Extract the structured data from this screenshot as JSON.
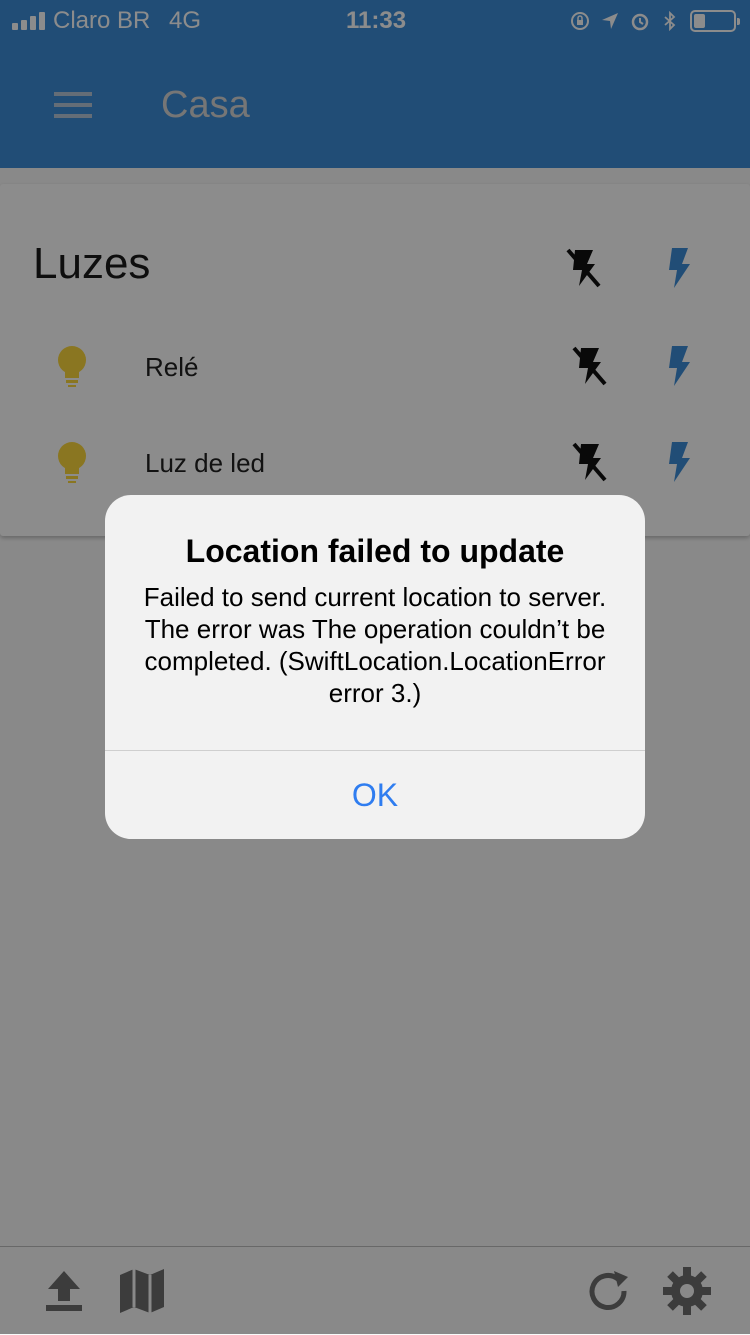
{
  "status_bar": {
    "carrier": "Claro BR",
    "network": "4G",
    "time": "11:33",
    "battery_level": 0.3
  },
  "header": {
    "title": "Casa",
    "menu_icon": "hamburger-menu-icon"
  },
  "card": {
    "title": "Luzes",
    "group_actions": {
      "off_icon": "flash-off-icon",
      "on_icon": "flash-on-icon"
    },
    "items": [
      {
        "label": "Relé",
        "icon": "lightbulb-icon"
      },
      {
        "label": "Luz de led",
        "icon": "lightbulb-icon"
      }
    ]
  },
  "alert": {
    "title": "Location failed to update",
    "message": "Failed to send current location to server. The error was The operation couldn’t be completed. (SwiftLocation.LocationError error 3.)",
    "ok_label": "OK"
  },
  "toolbar": {
    "left": [
      "upload-icon",
      "map-icon"
    ],
    "right": [
      "refresh-icon",
      "settings-icon"
    ]
  },
  "colors": {
    "header": "#3d8dd8",
    "bulb": "#fbd73c",
    "flash_on": "#3d8dd8",
    "alert_button": "#2f7df0"
  }
}
